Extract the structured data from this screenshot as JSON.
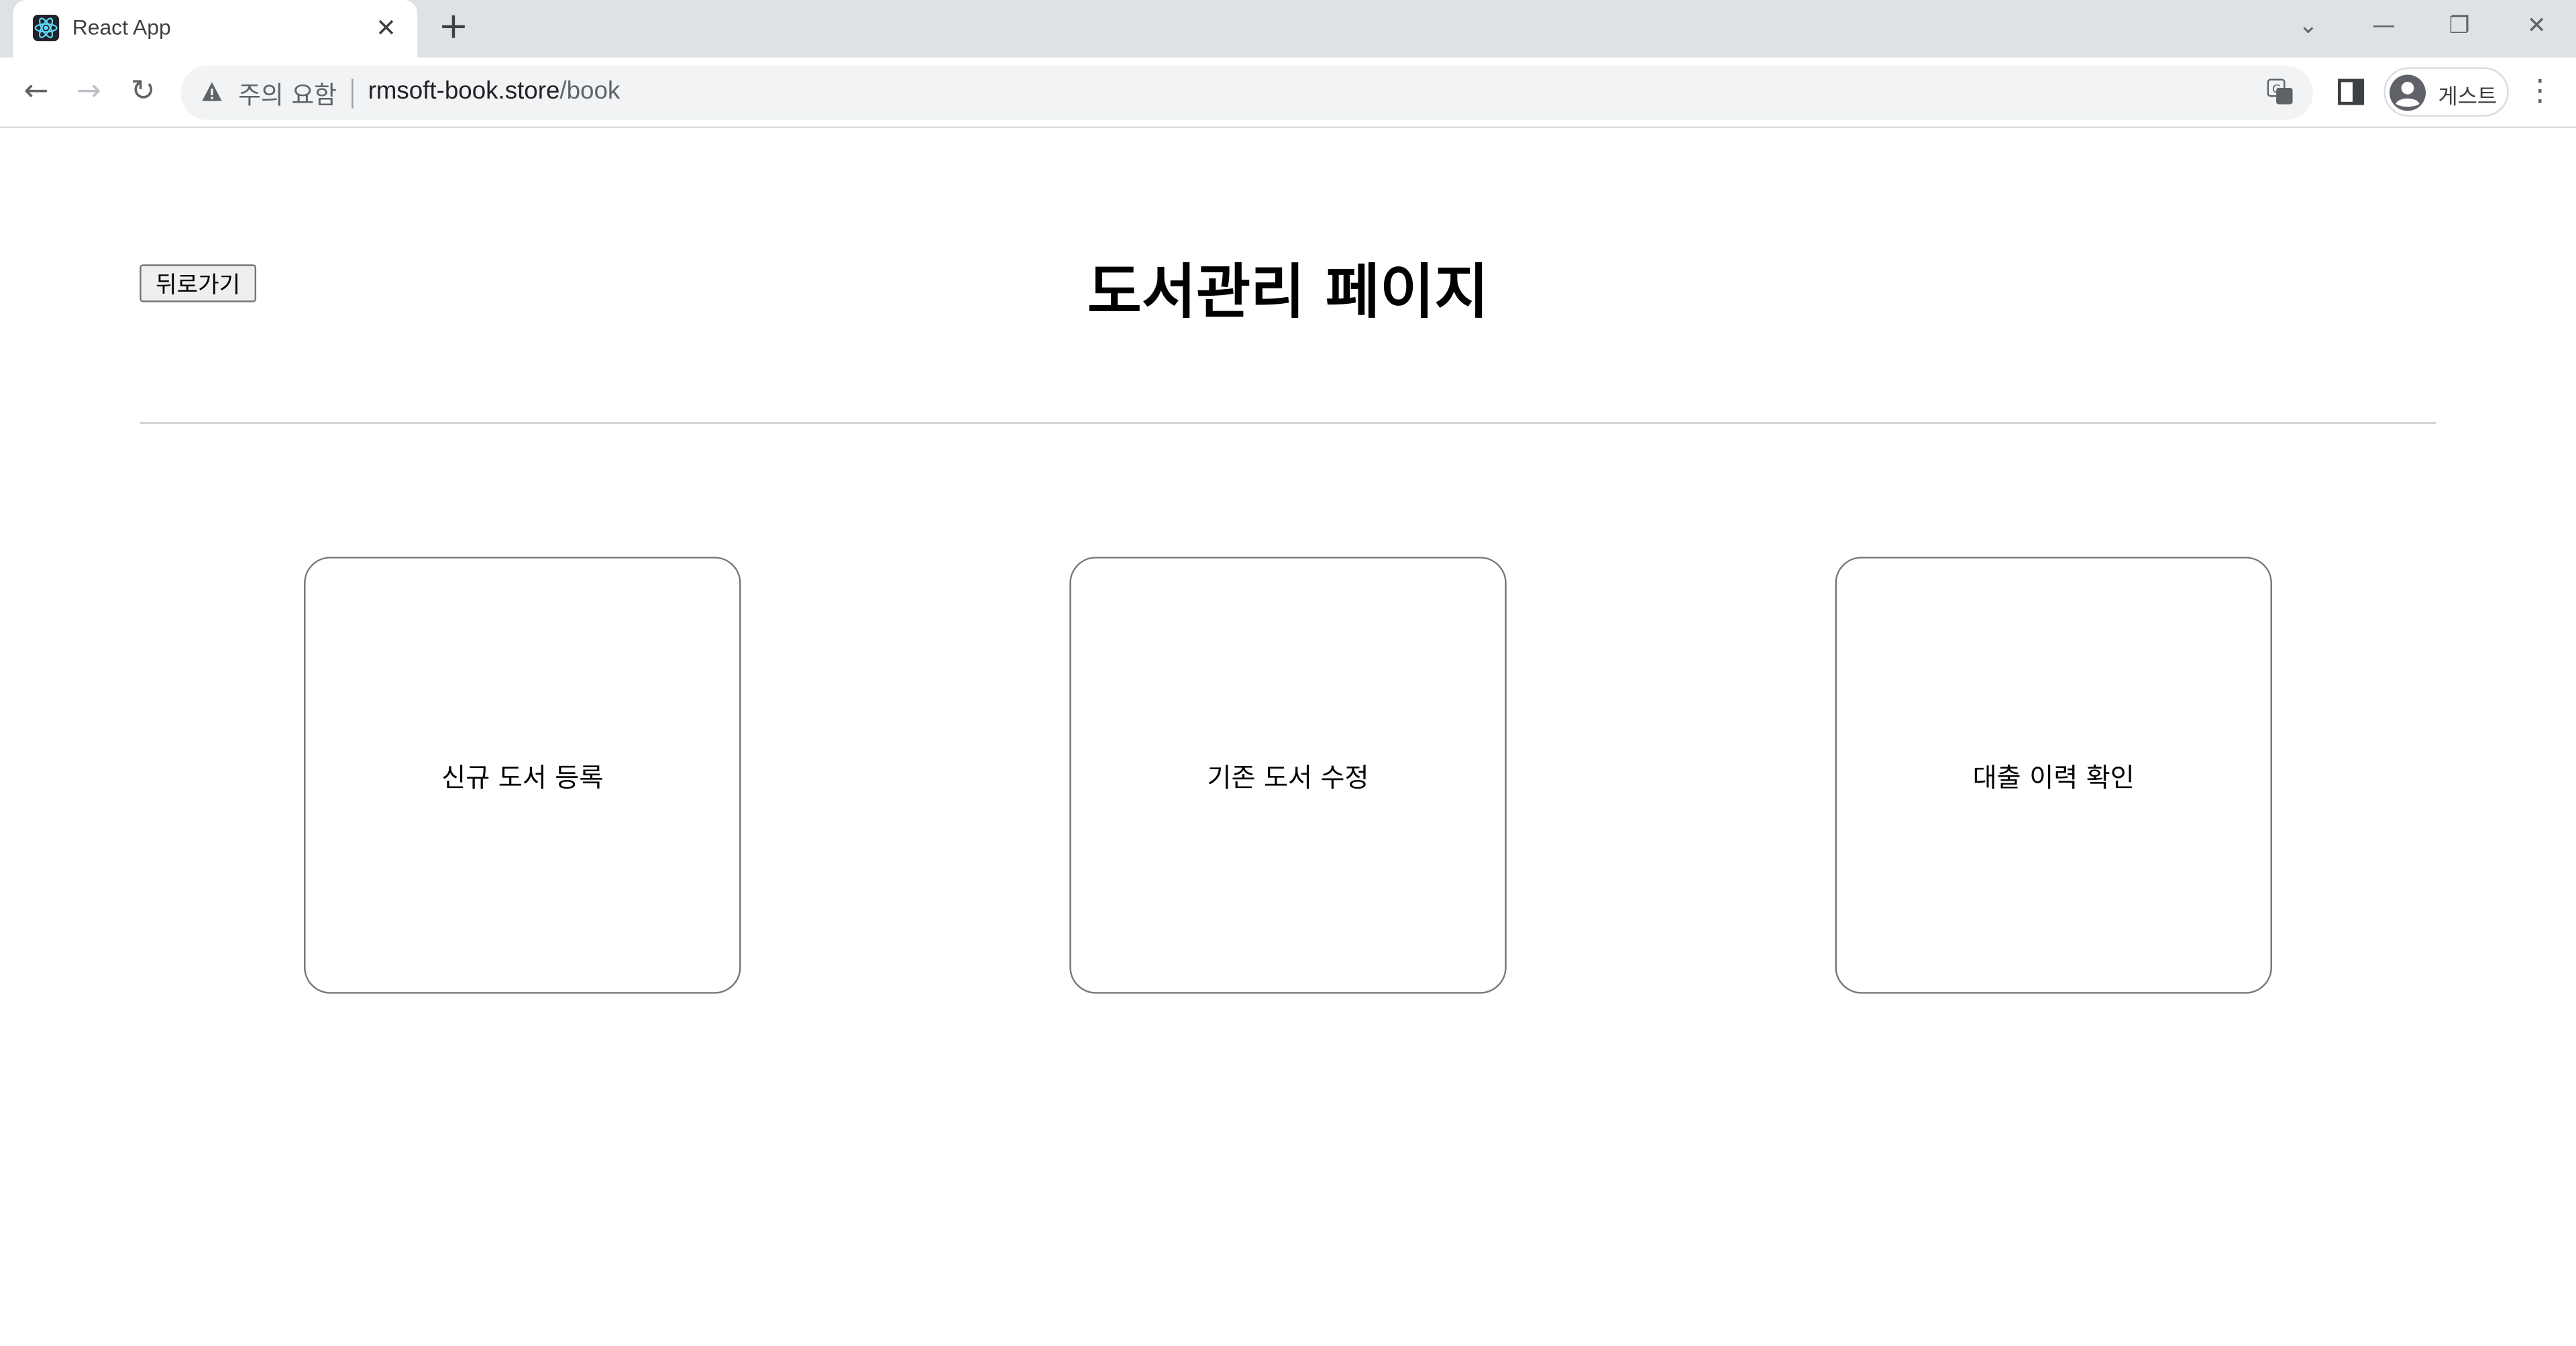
{
  "browser": {
    "tab_title": "React App",
    "tab_close": "✕",
    "new_tab": "+",
    "security_warning": "주의 요함",
    "url_host": "rmsoft-book.store",
    "url_path": "/book",
    "profile_label": "게스트",
    "window_controls": [
      "⌄",
      "—",
      "❐",
      "✕"
    ],
    "nav": {
      "back": "←",
      "forward": "→",
      "reload": "↻"
    },
    "menu": "⋮"
  },
  "page": {
    "back_button": "뒤로가기",
    "title": "도서관리 페이지",
    "cards": [
      {
        "label": "신규 도서 등록"
      },
      {
        "label": "기존 도서 수정"
      },
      {
        "label": "대출 이력 확인"
      }
    ]
  }
}
